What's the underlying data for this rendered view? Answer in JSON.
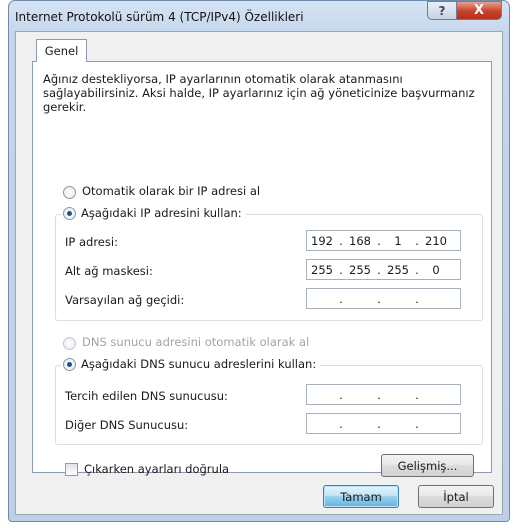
{
  "window": {
    "title": "Internet Protokolü sürüm 4 (TCP/IPv4) Özellikleri",
    "help_glyph": "?",
    "close_glyph": "X"
  },
  "tabs": [
    {
      "label": "Genel",
      "selected": true
    }
  ],
  "description": "Ağınız destekliyorsa, IP ayarlarının otomatik olarak atanmasını sağlayabilirsiniz. Aksi halde, IP ayarlarınız için ağ yöneticinize başvurmanız gerekir.",
  "ip_section": {
    "auto_label": "Otomatik olarak bir IP adresi al",
    "auto_selected": false,
    "manual_label": "Aşağıdaki IP adresini kullan:",
    "manual_selected": true,
    "fields": [
      {
        "label": "IP adresi:",
        "octets": [
          "192",
          "168",
          "1",
          "210"
        ]
      },
      {
        "label": "Alt ağ maskesi:",
        "octets": [
          "255",
          "255",
          "255",
          "0"
        ]
      },
      {
        "label": "Varsayılan ağ geçidi:",
        "octets": [
          "",
          "",
          "",
          ""
        ]
      }
    ]
  },
  "dns_section": {
    "auto_label": "DNS sunucu adresini otomatik olarak al",
    "auto_selected": false,
    "auto_disabled": true,
    "manual_label": "Aşağıdaki DNS sunucu adreslerini kullan:",
    "manual_selected": true,
    "fields": [
      {
        "label": "Tercih edilen DNS sunucusu:",
        "octets": [
          "",
          "",
          "",
          ""
        ]
      },
      {
        "label": "Diğer DNS Sunucusu:",
        "octets": [
          "",
          "",
          "",
          ""
        ]
      }
    ]
  },
  "validate_on_exit": {
    "label": "Çıkarken ayarları doğrula",
    "checked": false
  },
  "buttons": {
    "advanced": "Gelişmiş...",
    "ok": "Tamam",
    "cancel": "İptal"
  },
  "colors": {
    "title_bar": "#c4d6ec",
    "close_button": "#c7422b",
    "radio_selected": "#1e4f9a",
    "default_button": "#98d1ef"
  }
}
